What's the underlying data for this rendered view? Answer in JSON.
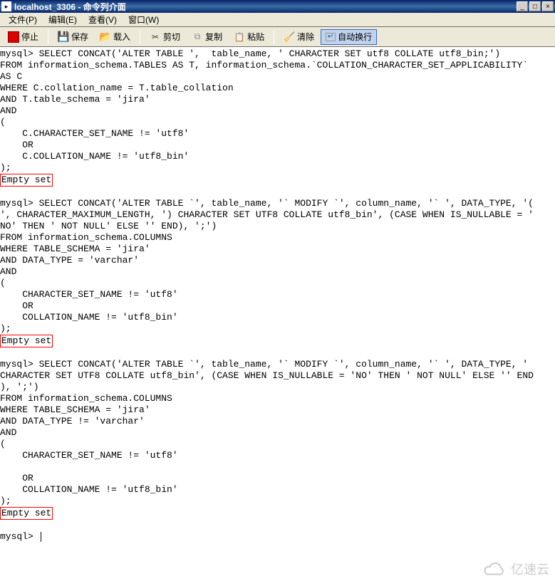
{
  "title": "localhost_3306 - 命令列介面",
  "menu": {
    "file": "文件(P)",
    "edit": "编辑(E)",
    "view": "查看(V)",
    "window": "窗口(W)"
  },
  "toolbar": {
    "stop": "停止",
    "save": "保存",
    "load": "载入",
    "cut": "剪切",
    "copy": "复制",
    "paste": "粘贴",
    "clear": "清除",
    "wrap": "自动换行"
  },
  "console": {
    "block1": "mysql> SELECT CONCAT('ALTER TABLE ',  table_name, ' CHARACTER SET utf8 COLLATE utf8_bin;')\nFROM information_schema.TABLES AS T, information_schema.`COLLATION_CHARACTER_SET_APPLICABILITY`\nAS C\nWHERE C.collation_name = T.table_collation\nAND T.table_schema = 'jira'\nAND\n(\n    C.CHARACTER_SET_NAME != 'utf8'\n    OR\n    C.COLLATION_NAME != 'utf8_bin'\n);",
    "empty1": "Empty set",
    "block2": "mysql> SELECT CONCAT('ALTER TABLE `', table_name, '` MODIFY `', column_name, '` ', DATA_TYPE, '(\n', CHARACTER_MAXIMUM_LENGTH, ') CHARACTER SET UTF8 COLLATE utf8_bin', (CASE WHEN IS_NULLABLE = '\nNO' THEN ' NOT NULL' ELSE '' END), ';')\nFROM information_schema.COLUMNS\nWHERE TABLE_SCHEMA = 'jira'\nAND DATA_TYPE = 'varchar'\nAND\n(\n    CHARACTER_SET_NAME != 'utf8'\n    OR\n    COLLATION_NAME != 'utf8_bin'\n);",
    "empty2": "Empty set",
    "block3": "mysql> SELECT CONCAT('ALTER TABLE `', table_name, '` MODIFY `', column_name, '` ', DATA_TYPE, '\nCHARACTER SET UTF8 COLLATE utf8_bin', (CASE WHEN IS_NULLABLE = 'NO' THEN ' NOT NULL' ELSE '' END\n), ';')\nFROM information_schema.COLUMNS\nWHERE TABLE_SCHEMA = 'jira'\nAND DATA_TYPE != 'varchar'\nAND\n(\n    CHARACTER_SET_NAME != 'utf8'\n\n    OR\n    COLLATION_NAME != 'utf8_bin'\n);",
    "empty3": "Empty set",
    "prompt": "mysql> "
  },
  "watermark": "亿速云"
}
